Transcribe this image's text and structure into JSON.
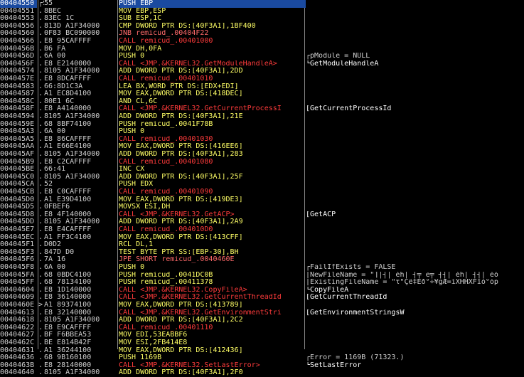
{
  "rows": [
    {
      "addr": "00404550",
      "br": "┌$",
      "hex": "55",
      "asm": "PUSH EBP",
      "cls": "push",
      "cmt": "",
      "sel": true
    },
    {
      "addr": "00404551",
      "br": ".",
      "hex": "8BEC",
      "asm": "MOV EBP,ESP",
      "cls": "push",
      "cmt": ""
    },
    {
      "addr": "00404553",
      "br": ".",
      "hex": "83EC 1C",
      "asm": "SUB ESP,1C",
      "cls": "push",
      "cmt": ""
    },
    {
      "addr": "00404556",
      "br": ".",
      "hex": "813D A1F34000",
      "asm": "CMP DWORD PTR DS:[40F3A1],1BF400",
      "cls": "push",
      "cmt": ""
    },
    {
      "addr": "00404560",
      "br": ".",
      "hex": "0F83 BC090000",
      "asm": "JNB remicud_.00404F22",
      "cls": "jmp",
      "cmt": ""
    },
    {
      "addr": "00404566",
      "br": ".",
      "hex": "E8 95CAFFFF",
      "asm": "CALL remicud_.00401000",
      "cls": "call",
      "cmt": ""
    },
    {
      "addr": "0040456B",
      "br": ".",
      "hex": "B6 FA",
      "asm": "MOV DH,0FA",
      "cls": "push",
      "cmt": ""
    },
    {
      "addr": "0040456D",
      "br": ".",
      "hex": "6A 00",
      "asm": "PUSH 0",
      "cls": "push",
      "cmt": "┌pModule = NULL"
    },
    {
      "addr": "0040456F",
      "br": ".",
      "hex": "E8 E2140000",
      "asm": "CALL <JMP.&KERNEL32.GetModuleHandleA>",
      "cls": "call",
      "cmt": "└GetModuleHandleA",
      "api": true
    },
    {
      "addr": "00404574",
      "br": ".",
      "hex": "8105 A1F34000",
      "asm": "ADD DWORD PTR DS:[40F3A1],2DD",
      "cls": "push",
      "cmt": ""
    },
    {
      "addr": "0040457E",
      "br": ".",
      "hex": "E8 8DCAFFFF",
      "asm": "CALL remicud_.00401010",
      "cls": "call",
      "cmt": ""
    },
    {
      "addr": "00404583",
      "br": ".",
      "hex": "66:8D1C3A",
      "asm": "LEA BX,WORD PTR DS:[EDX+EDI]",
      "cls": "push",
      "cmt": ""
    },
    {
      "addr": "00404587",
      "br": ".",
      "hex": "A1 EC8D4100",
      "asm": "MOV EAX,DWORD PTR DS:[418DEC]",
      "cls": "push",
      "cmt": ""
    },
    {
      "addr": "0040458C",
      "br": ".",
      "hex": "80E1 6C",
      "asm": "AND CL,6C",
      "cls": "push",
      "cmt": ""
    },
    {
      "addr": "0040458F",
      "br": ".",
      "hex": "E8 A4140000",
      "asm": "CALL <JMP.&KERNEL32.GetCurrentProcessI",
      "cls": "call",
      "cmt": "[GetCurrentProcessId",
      "api": true
    },
    {
      "addr": "00404594",
      "br": ".",
      "hex": "8105 A1F34000",
      "asm": "ADD DWORD PTR DS:[40F3A1],21E",
      "cls": "push",
      "cmt": ""
    },
    {
      "addr": "0040459E",
      "br": ".",
      "hex": "68 8BF74100",
      "asm": "PUSH remicud_.0041F78B",
      "cls": "push",
      "cmt": ""
    },
    {
      "addr": "004045A3",
      "br": ".",
      "hex": "6A 00",
      "asm": "PUSH 0",
      "cls": "push",
      "cmt": ""
    },
    {
      "addr": "004045A5",
      "br": ".",
      "hex": "E8 86CAFFFF",
      "asm": "CALL remicud_.00401030",
      "cls": "call",
      "cmt": ""
    },
    {
      "addr": "004045AA",
      "br": ".",
      "hex": "A1 E66E4100",
      "asm": "MOV EAX,DWORD PTR DS:[416EE6]",
      "cls": "push",
      "cmt": ""
    },
    {
      "addr": "004045AF",
      "br": ".",
      "hex": "8105 A1F34000",
      "asm": "ADD DWORD PTR DS:[40F3A1],283",
      "cls": "push",
      "cmt": ""
    },
    {
      "addr": "004045B9",
      "br": ".",
      "hex": "E8 C2CAFFFF",
      "asm": "CALL remicud_.00401080",
      "cls": "call",
      "cmt": ""
    },
    {
      "addr": "004045BE",
      "br": ".",
      "hex": "66:41",
      "asm": "INC CX",
      "cls": "push",
      "cmt": ""
    },
    {
      "addr": "004045C0",
      "br": ".",
      "hex": "8105 A1F34000",
      "asm": "ADD DWORD PTR DS:[40F3A1],25F",
      "cls": "push",
      "cmt": ""
    },
    {
      "addr": "004045CA",
      "br": ".",
      "hex": "52",
      "asm": "PUSH EDX",
      "cls": "push",
      "cmt": ""
    },
    {
      "addr": "004045CB",
      "br": ".",
      "hex": "E8 C0CAFFFF",
      "asm": "CALL remicud_.00401090",
      "cls": "call",
      "cmt": ""
    },
    {
      "addr": "004045D0",
      "br": ".",
      "hex": "A1 E39D4100",
      "asm": "MOV EAX,DWORD PTR DS:[419DE3]",
      "cls": "push",
      "cmt": ""
    },
    {
      "addr": "004045D5",
      "br": ".",
      "hex": "0FBEF6",
      "asm": "MOVSX ESI,DH",
      "cls": "push",
      "cmt": ""
    },
    {
      "addr": "004045D8",
      "br": ".",
      "hex": "E8 4F140000",
      "asm": "CALL <JMP.&KERNEL32.GetACP>",
      "cls": "call",
      "cmt": "[GetACP",
      "api": true
    },
    {
      "addr": "004045DD",
      "br": ".",
      "hex": "8105 A1F34000",
      "asm": "ADD DWORD PTR DS:[40F3A1],2A9",
      "cls": "push",
      "cmt": ""
    },
    {
      "addr": "004045E7",
      "br": ".",
      "hex": "E8 E4CAFFFF",
      "asm": "CALL remicud_.004010D0",
      "cls": "call",
      "cmt": ""
    },
    {
      "addr": "004045EC",
      "br": ".",
      "hex": "A1 FF3C4100",
      "asm": "MOV EAX,DWORD PTR DS:[413CFF]",
      "cls": "push",
      "cmt": ""
    },
    {
      "addr": "004045F1",
      "br": ".",
      "hex": "D0D2",
      "asm": "RCL DL,1",
      "cls": "push",
      "cmt": ""
    },
    {
      "addr": "004045F3",
      "br": ".",
      "hex": "847D D0",
      "asm": "TEST BYTE PTR SS:[EBP-30],BH",
      "cls": "push",
      "cmt": ""
    },
    {
      "addr": "004045F6",
      "br": ".",
      "hex": "7A 16",
      "asm": "JPE SHORT remicud_.0040460E",
      "cls": "jmp",
      "cmt": ""
    },
    {
      "addr": "004045F8",
      "br": ".",
      "hex": "6A 00",
      "asm": "PUSH 0",
      "cls": "push",
      "cmt": "┌FailIfExists = FALSE"
    },
    {
      "addr": "004045FA",
      "br": ".",
      "hex": "68 0BDC4100",
      "asm": "PUSH remicud_.0041DC0B",
      "cls": "push",
      "cmt": "|NewFileName = \"⌉│┤│ éh│ ┤╤ e╤ ┤┤│ éh│ ┤┤│ éó"
    },
    {
      "addr": "004045FF",
      "br": ".",
      "hex": "68 78134100",
      "asm": "PUSH remicud_.00411378",
      "cls": "push",
      "cmt": "|ExistingFileName = \"τ\"Çê‡Éð°÷¥gÆ=íXHHXFîó°óp"
    },
    {
      "addr": "00404604",
      "br": ".",
      "hex": "E8 1D140000",
      "asm": "CALL <JMP.&KERNEL32.CopyFileA>",
      "cls": "call",
      "cmt": "└CopyFileA",
      "api": true
    },
    {
      "addr": "00404609",
      "br": ".",
      "hex": "E8 36140000",
      "asm": "CALL <JMP.&KERNEL32.GetCurrentThreadId",
      "cls": "call",
      "cmt": "[GetCurrentThreadId",
      "api": true
    },
    {
      "addr": "0040460E",
      "br": ">",
      "hex": "A1 89374100",
      "asm": "MOV EAX,DWORD PTR DS:[413789]",
      "cls": "push",
      "cmt": ""
    },
    {
      "addr": "00404613",
      "br": ".",
      "hex": "E8 32140000",
      "asm": "CALL <JMP.&KERNEL32.GetEnvironmentStri",
      "cls": "call",
      "cmt": "[GetEnvironmentStringsW",
      "api": true
    },
    {
      "addr": "00404618",
      "br": ".",
      "hex": "8105 A1F34000",
      "asm": "ADD DWORD PTR DS:[40F3A1],2C2",
      "cls": "push",
      "cmt": ""
    },
    {
      "addr": "00404622",
      "br": ".",
      "hex": "E8 E9CAFFFF",
      "asm": "CALL remicud_.00401110",
      "cls": "call",
      "cmt": ""
    },
    {
      "addr": "00404627",
      "br": ".",
      "hex": "BF F6BBEA53",
      "asm": "MOV EDI,53EABBF6",
      "cls": "push",
      "cmt": ""
    },
    {
      "addr": "0040462C",
      "br": ".",
      "hex": "BE E814B42F",
      "asm": "MOV ESI,2FB414E8",
      "cls": "push",
      "cmt": ""
    },
    {
      "addr": "00404631",
      "br": ".",
      "hex": "A1 36244100",
      "asm": "MOV EAX,DWORD PTR DS:[412436]",
      "cls": "push",
      "cmt": ""
    },
    {
      "addr": "00404636",
      "br": ".",
      "hex": "68 9B160100",
      "asm": "PUSH 1169B",
      "cls": "push",
      "cmt": "┌Error = 1169B (71323.)"
    },
    {
      "addr": "0040463B",
      "br": ".",
      "hex": "E8 28140000",
      "asm": "CALL <JMP.&KERNEL32.SetLastError>",
      "cls": "call",
      "cmt": "└SetLastError",
      "api": true
    },
    {
      "addr": "00404640",
      "br": ".",
      "hex": "8105 A1F34000",
      "asm": "ADD DWORD PTR DS:[40F3A1],2F0",
      "cls": "push",
      "cmt": ""
    }
  ]
}
